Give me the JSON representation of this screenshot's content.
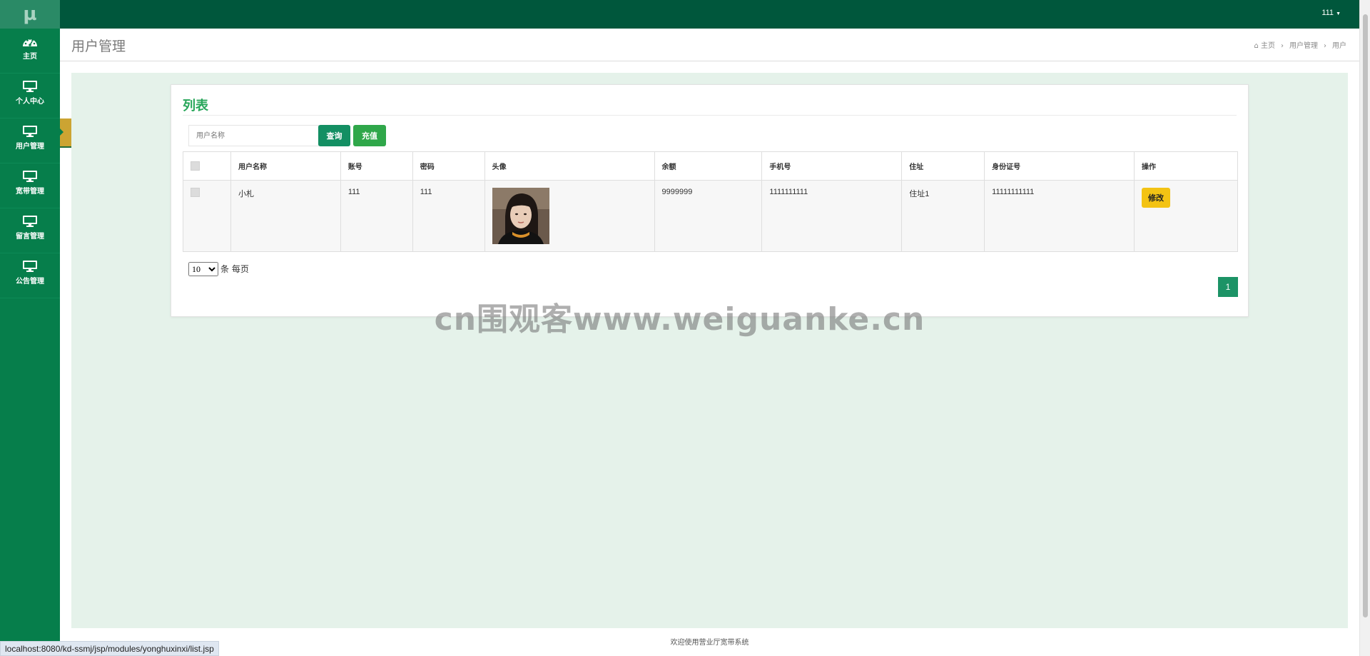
{
  "app": {
    "logo": "µ",
    "user_menu_label": "111"
  },
  "sidebar": {
    "items": [
      {
        "label": "主页",
        "icon": "dashboard-icon"
      },
      {
        "label": "个人中心",
        "icon": "monitor-icon"
      },
      {
        "label": "用户管理",
        "icon": "monitor-icon"
      },
      {
        "label": "宽带管理",
        "icon": "monitor-icon"
      },
      {
        "label": "留言管理",
        "icon": "monitor-icon"
      },
      {
        "label": "公告管理",
        "icon": "monitor-icon"
      }
    ],
    "submenu_label": "用户"
  },
  "header": {
    "title": "用户管理",
    "breadcrumb": [
      "主页",
      "用户管理",
      "用户"
    ]
  },
  "panel": {
    "title": "列表",
    "search_placeholder": "用户名称",
    "query_label": "查询",
    "recharge_label": "充值"
  },
  "table": {
    "columns": [
      "用户名称",
      "账号",
      "密码",
      "头像",
      "余额",
      "手机号",
      "住址",
      "身份证号",
      "操作"
    ],
    "rows": [
      {
        "name": "小札",
        "account": "111",
        "password": "111",
        "balance": "9999999",
        "phone": "1111111111",
        "address": "住址1",
        "id_number": "11111111111",
        "action_label": "修改"
      }
    ]
  },
  "pagination": {
    "page_size": "10",
    "page_size_suffix": "条 每页",
    "current_page": "1"
  },
  "footer": {
    "text": "欢迎使用营业厅宽带系统",
    "status_url": "localhost:8080/kd-ssmj/jsp/modules/yonghuxinxi/list.jsp"
  },
  "watermark": "cn围观客www.weiguanke.cn"
}
